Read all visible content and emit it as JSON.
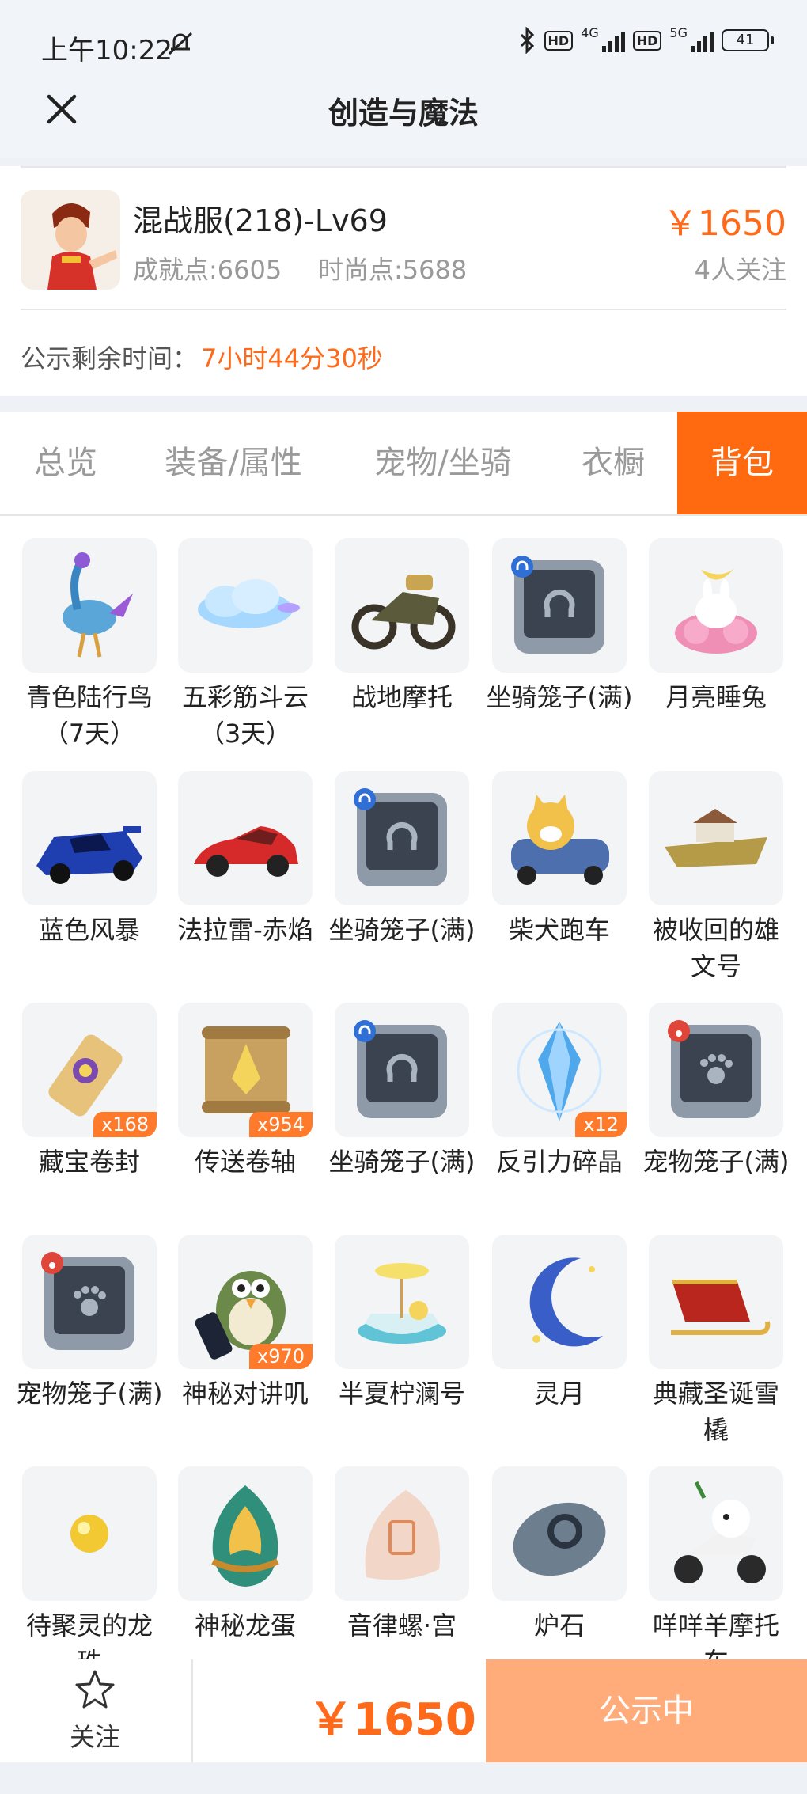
{
  "status_bar": {
    "time": "上午10:22",
    "network_a": "4G",
    "network_b": "5G",
    "battery": "41",
    "hd_label": "HD"
  },
  "nav": {
    "title": "创造与魔法"
  },
  "character": {
    "name": "混战服(218)-Lv69",
    "achievement": "成就点:6605",
    "fashion": "时尚点:5688",
    "price": "￥1650",
    "followers": "4人关注"
  },
  "notice": {
    "label": "公示剩余时间：",
    "time": "7小时44分30秒"
  },
  "tabs": [
    {
      "label": "总览",
      "active": false
    },
    {
      "label": "装备/属性",
      "active": false
    },
    {
      "label": "宠物/坐骑",
      "active": false
    },
    {
      "label": "衣橱",
      "active": false
    },
    {
      "label": "背包",
      "active": true
    }
  ],
  "items": [
    {
      "name": "青色陆行鸟（7天）",
      "icon": "blue-bird-icon",
      "qty": null
    },
    {
      "name": "五彩筋斗云（3天）",
      "icon": "cloud-icon",
      "qty": null
    },
    {
      "name": "战地摩托",
      "icon": "motorcycle-icon",
      "qty": null
    },
    {
      "name": "坐骑笼子(满)",
      "icon": "mount-cage-icon",
      "qty": null
    },
    {
      "name": "月亮睡兔",
      "icon": "moon-rabbit-icon",
      "qty": null
    },
    {
      "name": "蓝色风暴",
      "icon": "blue-racecar-icon",
      "qty": null
    },
    {
      "name": "法拉雷-赤焰",
      "icon": "red-sportscar-icon",
      "qty": null
    },
    {
      "name": "坐骑笼子(满)",
      "icon": "mount-cage-icon",
      "qty": null
    },
    {
      "name": "柴犬跑车",
      "icon": "shiba-car-icon",
      "qty": null
    },
    {
      "name": "被收回的雄文号",
      "icon": "ship-icon",
      "qty": null
    },
    {
      "name": "藏宝卷封",
      "icon": "treasure-scroll-icon",
      "qty": "x168"
    },
    {
      "name": "传送卷轴",
      "icon": "teleport-scroll-icon",
      "qty": "x954"
    },
    {
      "name": "坐骑笼子(满)",
      "icon": "mount-cage-icon",
      "qty": null
    },
    {
      "name": "反引力碎晶",
      "icon": "crystal-icon",
      "qty": "x12"
    },
    {
      "name": "宠物笼子(满)",
      "icon": "pet-cage-icon",
      "qty": null
    },
    {
      "name": "宠物笼子(满)",
      "icon": "pet-cage-icon",
      "qty": null
    },
    {
      "name": "神秘对讲叽",
      "icon": "walkie-bird-icon",
      "qty": "x970"
    },
    {
      "name": "半夏柠澜号",
      "icon": "lemon-boat-icon",
      "qty": null
    },
    {
      "name": "灵月",
      "icon": "crescent-moon-icon",
      "qty": null
    },
    {
      "name": "典藏圣诞雪橇",
      "icon": "sleigh-icon",
      "qty": null
    },
    {
      "name": "待聚灵的龙珠",
      "icon": "dragon-pearl-icon",
      "qty": null
    },
    {
      "name": "神秘龙蛋",
      "icon": "dragon-egg-icon",
      "qty": null
    },
    {
      "name": "音律螺·宫",
      "icon": "conch-icon",
      "qty": null
    },
    {
      "name": "炉石",
      "icon": "hearthstone-icon",
      "qty": null
    },
    {
      "name": "咩咩羊摩托车",
      "icon": "sheep-scooter-icon",
      "qty": null
    }
  ],
  "bottom": {
    "follow_label": "关注",
    "price": "￥1650",
    "cta": "公示中"
  },
  "colors": {
    "accent": "#ff6a10",
    "cta_disabled": "#ffab7a",
    "price": "#ff6a1a"
  }
}
